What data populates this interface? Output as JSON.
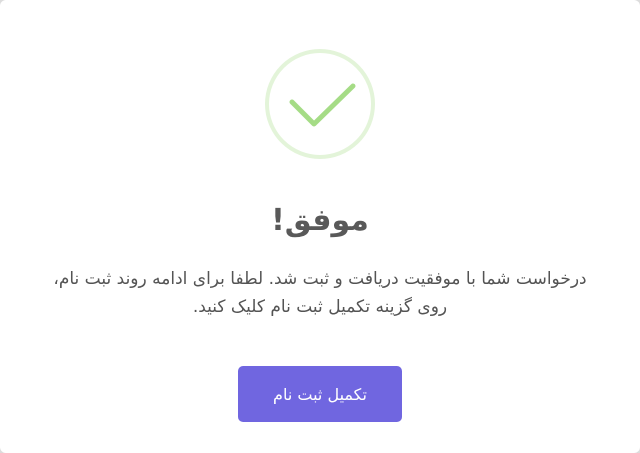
{
  "dialog": {
    "icon": "success-check-icon",
    "icon_colors": {
      "ring": "#e3f4d9",
      "check": "#a5dc86"
    },
    "title": "موفق!",
    "message": "درخواست شما با موفقیت دریافت و ثبت شد. لطفا برای ادامه روند ثبت نام، روی گزینه تکمیل ثبت نام کلیک کنید.",
    "confirm_label": "تکمیل ثبت نام",
    "confirm_color": "#7066e0"
  }
}
